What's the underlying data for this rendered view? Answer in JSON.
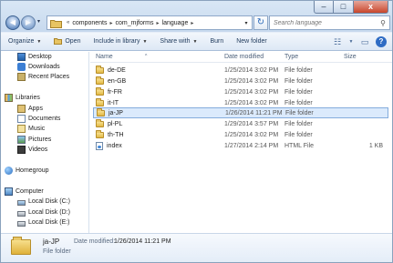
{
  "window": {
    "controls": {
      "minimize": "–",
      "maximize": "□",
      "close": "x"
    }
  },
  "address": {
    "prefix": "«",
    "crumbs": [
      "components",
      "com_mjforms",
      "language"
    ],
    "separator": "▸",
    "dropdown": "▾"
  },
  "search": {
    "placeholder": "Search language"
  },
  "toolbar": {
    "organize": "Organize",
    "open": "Open",
    "include_in_library": "Include in library",
    "share_with": "Share with",
    "burn": "Burn",
    "new_folder": "New folder",
    "caret": "▼"
  },
  "sidebar": {
    "favorites": [
      {
        "label": "Desktop",
        "icon": "desktop-icon"
      },
      {
        "label": "Downloads",
        "icon": "downloads-icon"
      },
      {
        "label": "Recent Places",
        "icon": "recent-places-icon"
      }
    ],
    "libraries_label": "Libraries",
    "libraries": [
      {
        "label": "Apps",
        "icon": "apps-library-icon"
      },
      {
        "label": "Documents",
        "icon": "documents-icon"
      },
      {
        "label": "Music",
        "icon": "music-icon"
      },
      {
        "label": "Pictures",
        "icon": "pictures-icon"
      },
      {
        "label": "Videos",
        "icon": "videos-icon"
      }
    ],
    "homegroup_label": "Homegroup",
    "computer_label": "Computer",
    "drives": [
      {
        "label": "Local Disk (C:)"
      },
      {
        "label": "Local Disk (D:)"
      },
      {
        "label": "Local Disk (E:)"
      }
    ]
  },
  "columns": {
    "name": "Name",
    "date_modified": "Date modified",
    "type": "Type",
    "size": "Size",
    "sort_indicator": "^"
  },
  "files": [
    {
      "name": "de-DE",
      "date": "1/25/2014 3:02 PM",
      "type": "File folder",
      "size": ""
    },
    {
      "name": "en-GB",
      "date": "1/25/2014 3:02 PM",
      "type": "File folder",
      "size": ""
    },
    {
      "name": "fr-FR",
      "date": "1/25/2014 3:02 PM",
      "type": "File folder",
      "size": ""
    },
    {
      "name": "it-IT",
      "date": "1/25/2014 3:02 PM",
      "type": "File folder",
      "size": ""
    },
    {
      "name": "ja-JP",
      "date": "1/26/2014 11:21 PM",
      "type": "File folder",
      "size": "",
      "selected": true
    },
    {
      "name": "pl-PL",
      "date": "1/29/2014 3:57 PM",
      "type": "File folder",
      "size": ""
    },
    {
      "name": "th-TH",
      "date": "1/25/2014 3:02 PM",
      "type": "File folder",
      "size": ""
    },
    {
      "name": "index",
      "date": "1/27/2014 2:14 PM",
      "type": "HTML File",
      "size": "1 KB"
    }
  ],
  "details": {
    "name": "ja-JP",
    "type": "File folder",
    "date_label": "Date modified:",
    "date_value": "1/26/2014 11:21 PM"
  }
}
